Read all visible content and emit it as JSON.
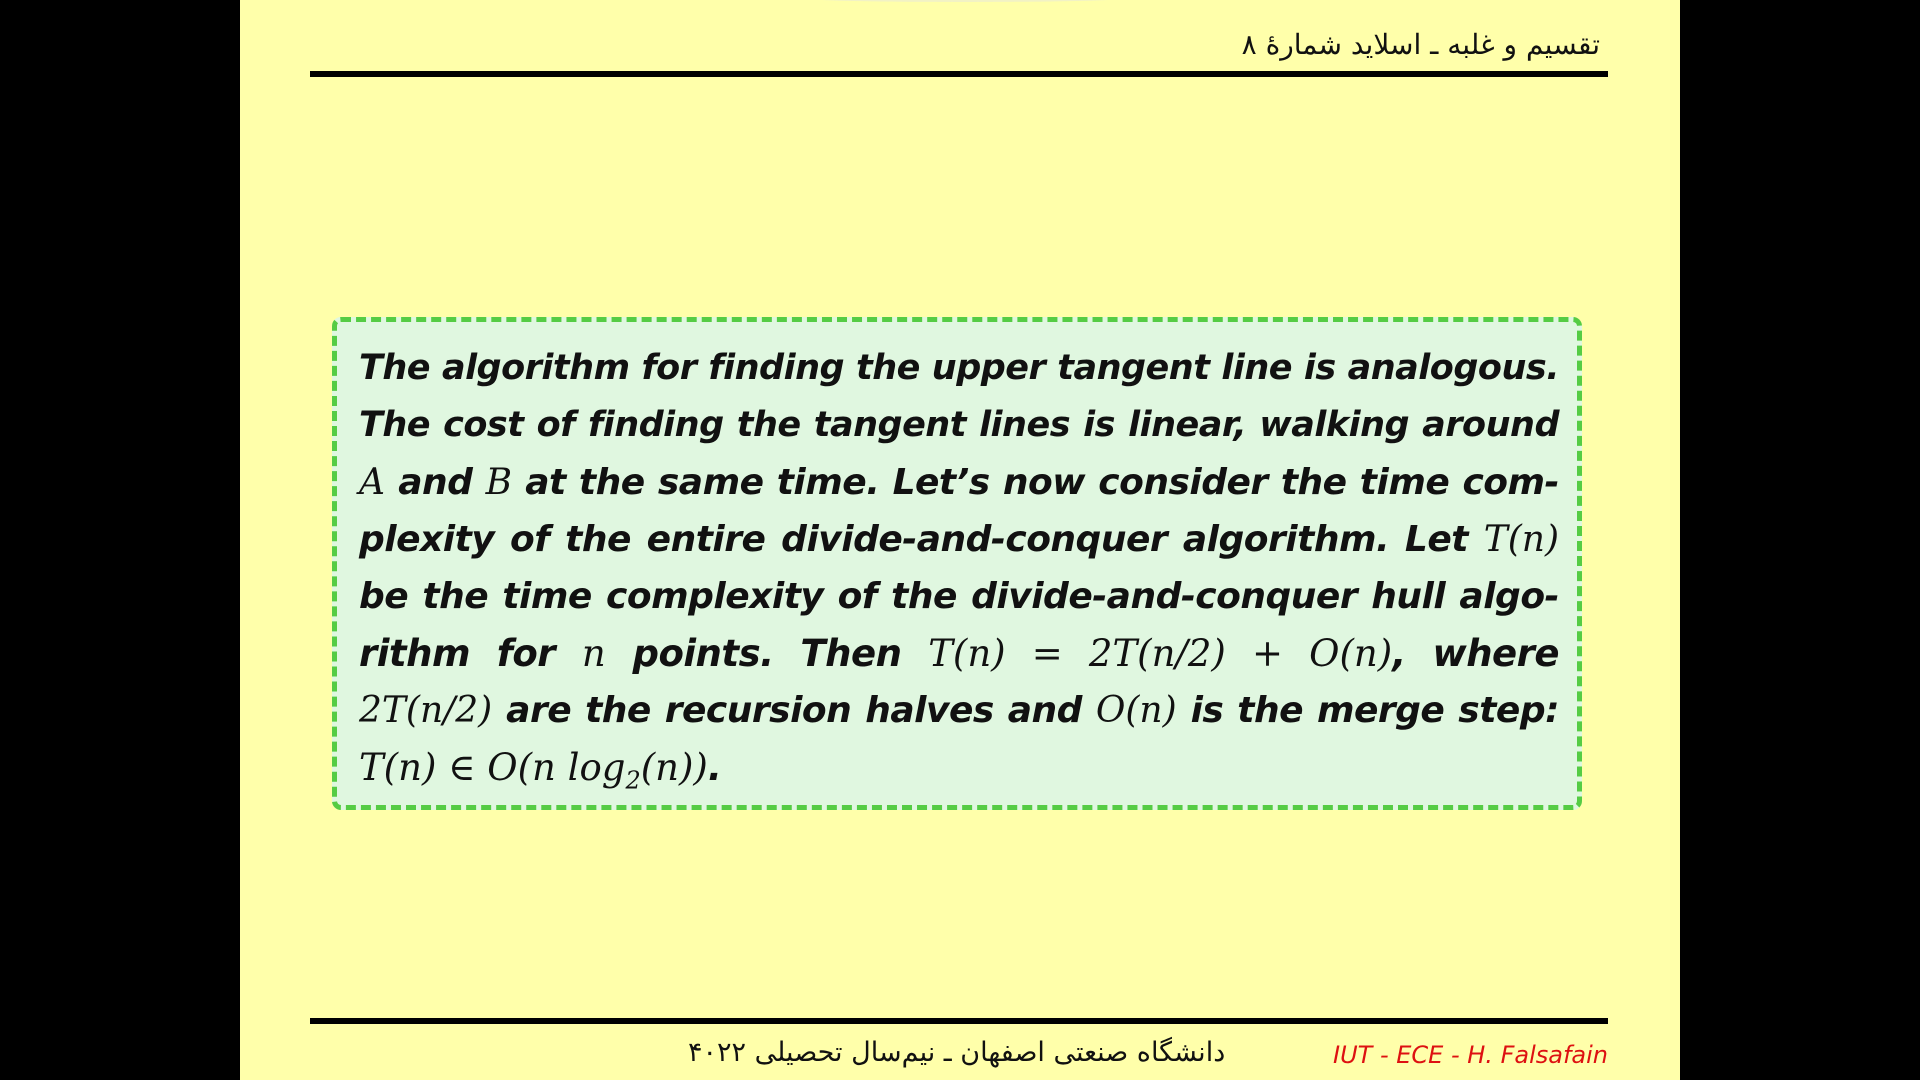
{
  "header": {
    "title": "تقسیم و غلبه ـ اسلاید شمارهٔ ۸"
  },
  "content": {
    "lines": [
      [
        "The algorithm for finding the upper tangent line is analogous."
      ],
      [
        "The cost of finding the tangent lines is linear, walking around"
      ],
      [
        "A",
        " and ",
        "B",
        " at the same time.  Let’s now consider the time com-"
      ],
      [
        "plexity of the entire divide-and-conquer algorithm.  Let ",
        "T(n)"
      ],
      [
        "be the time complexity of the divide-and-conquer hull algo-"
      ],
      [
        "rithm for ",
        "n",
        " points.  Then ",
        "T(n)  =  2T(n/2) + O(n)",
        ", where"
      ],
      [
        "2T(n/2)",
        " are the recursion halves and ",
        "O(n)",
        " is the merge step:"
      ],
      [
        "T(n) ∈ O(n log",
        "2",
        "(n))",
        "."
      ]
    ]
  },
  "footer": {
    "university": "دانشگاه صنعتی اصفهان ـ نیم‌سال تحصیلی ۴۰۲۲",
    "author": "IUT - ECE - H. Falsafain"
  },
  "colors": {
    "background": "#ffffaa",
    "box_fill": "#e0f7e0",
    "box_border": "#55cc44",
    "author_text": "#dd1111"
  }
}
